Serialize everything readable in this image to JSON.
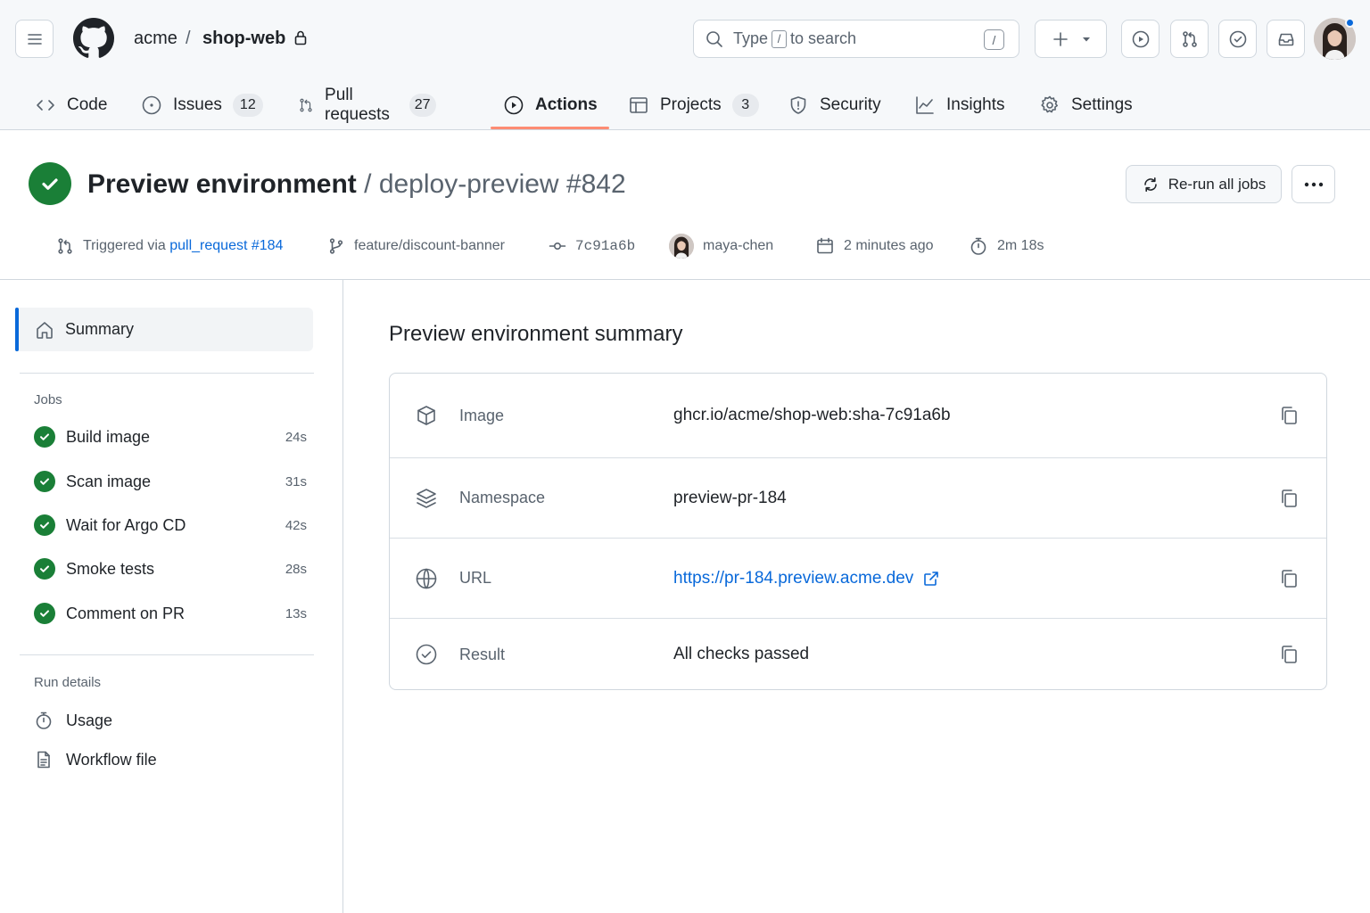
{
  "repo": {
    "owner": "acme",
    "separator": "/",
    "name": "shop-web"
  },
  "search": {
    "prefix": "Type",
    "key": "/",
    "suffix": "to search",
    "shortcut": "/"
  },
  "nav": {
    "tabs": [
      {
        "label": "Code",
        "icon": "code-icon",
        "count": null
      },
      {
        "label": "Issues",
        "icon": "issue-icon",
        "count": "12"
      },
      {
        "label": "Pull requests",
        "icon": "pull-request-icon",
        "count": "27"
      },
      {
        "label": "Actions",
        "icon": "play-icon",
        "count": null,
        "active": true
      },
      {
        "label": "Projects",
        "icon": "table-icon",
        "count": "3"
      },
      {
        "label": "Security",
        "icon": "shield-icon",
        "count": null
      },
      {
        "label": "Insights",
        "icon": "graph-icon",
        "count": null
      },
      {
        "label": "Settings",
        "icon": "gear-icon",
        "count": null
      }
    ]
  },
  "run": {
    "workflow_name": "Preview environment",
    "separator": "/",
    "run_title": "deploy-preview #842",
    "rerun_label": "Re-run all jobs",
    "meta": {
      "trigger_prefix": "Triggered via",
      "trigger_link": "pull_request #184",
      "branch": "feature/discount-banner",
      "commit": "7c91a6b",
      "actor": "maya-chen",
      "time": "2 minutes ago",
      "duration": "2m 18s"
    }
  },
  "sidebar": {
    "summary_label": "Summary",
    "jobs_heading": "Jobs",
    "jobs": [
      {
        "name": "Build image",
        "duration": "24s",
        "status": "success"
      },
      {
        "name": "Scan image",
        "duration": "31s",
        "status": "success"
      },
      {
        "name": "Wait for Argo CD",
        "duration": "42s",
        "status": "success"
      },
      {
        "name": "Smoke tests",
        "duration": "28s",
        "status": "success"
      },
      {
        "name": "Comment on PR",
        "duration": "13s",
        "status": "success"
      }
    ],
    "run_details_heading": "Run details",
    "run_details": [
      {
        "label": "Usage",
        "icon": "stopwatch-icon"
      },
      {
        "label": "Workflow file",
        "icon": "file-icon"
      }
    ]
  },
  "summary": {
    "title": "Preview environment summary",
    "rows": [
      {
        "label": "Image",
        "value": "ghcr.io/acme/shop-web:sha-7c91a6b",
        "icon": "package-icon"
      },
      {
        "label": "Namespace",
        "value": "preview-pr-184",
        "icon": "stack-icon"
      },
      {
        "label": "URL",
        "value": "https://pr-184.preview.acme.dev",
        "icon": "globe-icon",
        "is_link": true
      },
      {
        "label": "Result",
        "value": "All checks passed",
        "icon": "check-circle-icon"
      }
    ]
  },
  "colors": {
    "success": "#1a7f37",
    "link": "#0969da",
    "active_tab_underline": "#fd8c73",
    "notification": "#0969da"
  }
}
